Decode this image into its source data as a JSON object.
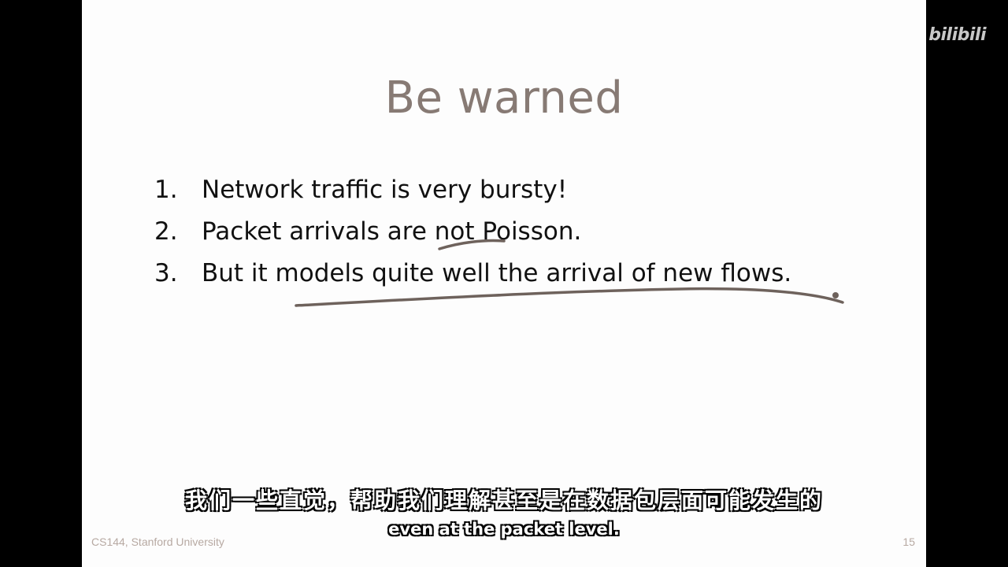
{
  "slide": {
    "title": "Be warned",
    "bullets": [
      {
        "num": "1.",
        "text": "Network traffic is very bursty!"
      },
      {
        "num": "2.",
        "text": "Packet arrivals are not Poisson."
      },
      {
        "num": "3.",
        "text": "But it models quite well the arrival of new flows."
      }
    ],
    "footer_left": "CS144, Stanford University",
    "page_number": "15"
  },
  "subtitles": {
    "chinese": "我们一些直觉，帮助我们理解甚至是在数据包层面可能发生的",
    "english": "even at the packet level."
  },
  "watermark": {
    "text": "bilibili"
  },
  "colors": {
    "title": "#877a74",
    "ink": "#6e625c",
    "footer": "#b7a9a2",
    "letterbox": "#000000"
  }
}
